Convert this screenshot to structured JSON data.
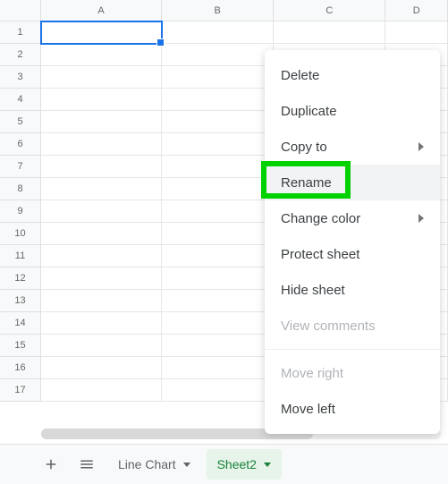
{
  "columns": [
    "A",
    "B",
    "C",
    "D"
  ],
  "rows": [
    1,
    2,
    3,
    4,
    5,
    6,
    7,
    8,
    9,
    10,
    11,
    12,
    13,
    14,
    15,
    16,
    17
  ],
  "active_cell": "A1",
  "sheets": {
    "tab1": {
      "label": "Line Chart"
    },
    "tab2": {
      "label": "Sheet2",
      "active": true
    }
  },
  "context_menu": {
    "delete": "Delete",
    "duplicate": "Duplicate",
    "copy_to": "Copy to",
    "rename": "Rename",
    "change_color": "Change color",
    "protect_sheet": "Protect sheet",
    "hide_sheet": "Hide sheet",
    "view_comments": "View comments",
    "move_right": "Move right",
    "move_left": "Move left"
  }
}
